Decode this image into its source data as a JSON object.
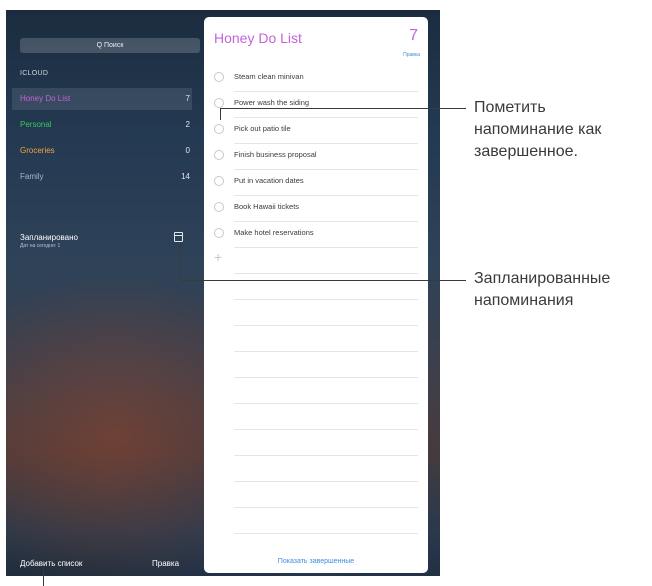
{
  "sidebar": {
    "search_placeholder": "Q Поиск",
    "section_label": "ICLOUD",
    "lists": [
      {
        "name": "Honey Do List",
        "count": "7",
        "color": "#c364d9"
      },
      {
        "name": "Personal",
        "count": "2",
        "color": "#35c759"
      },
      {
        "name": "Groceries",
        "count": "0",
        "color": "#f2a33a"
      },
      {
        "name": "Family",
        "count": "14",
        "color": "#a9b6c4"
      }
    ],
    "scheduled": {
      "title": "Запланировано",
      "subtitle": "Дат на сегодня: 1"
    },
    "add_list": "Добавить список",
    "edit": "Правка"
  },
  "reminders": {
    "title": "Honey Do List",
    "count": "7",
    "edit": "Правка",
    "items": [
      "Steam clean minivan",
      "Power wash the siding",
      "Pick out patio tile",
      "Finish business proposal",
      "Put in vacation dates",
      "Book Hawaii tickets",
      "Make hotel reservations"
    ],
    "add_symbol": "+",
    "show_completed": "Показать завершенные"
  },
  "callouts": {
    "mark_complete": [
      "Пометить",
      "напоминание как",
      "завершенное."
    ],
    "scheduled": [
      "Запланированные",
      "напоминания"
    ]
  },
  "colors": {
    "accent": "#c364d9",
    "link": "#3b8ee0"
  }
}
